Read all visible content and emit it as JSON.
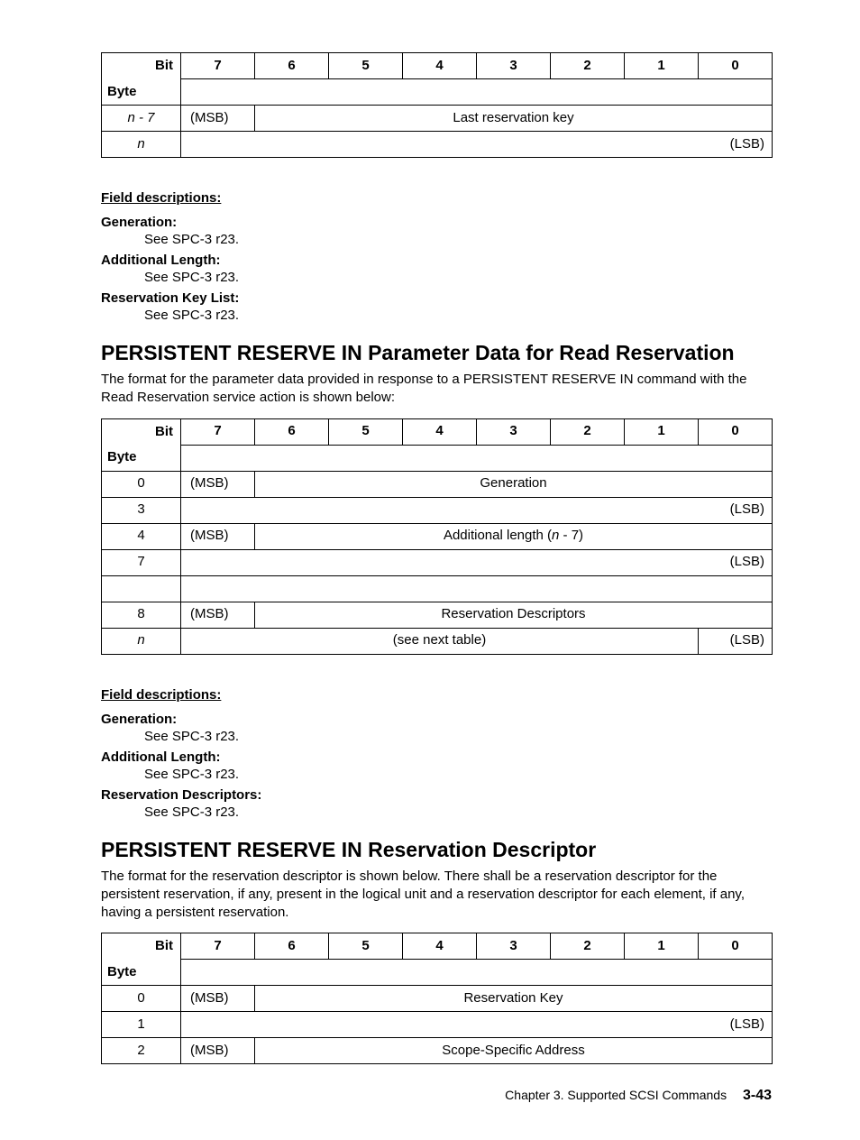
{
  "bitHeader": {
    "bit": "Bit",
    "byte": "Byte",
    "cols": [
      "7",
      "6",
      "5",
      "4",
      "3",
      "2",
      "1",
      "0"
    ]
  },
  "tableA": {
    "row_msb_byte": "n - 7",
    "row_msb_msb": "(MSB)",
    "row_msb_text": "Last reservation key",
    "row_lsb_byte": "n",
    "row_lsb_lsb": "(LSB)"
  },
  "fdA": {
    "title": "Field descriptions:",
    "items": [
      {
        "term": "Generation:",
        "def": "See SPC-3 r23."
      },
      {
        "term": "Additional Length:",
        "def": "See SPC-3 r23."
      },
      {
        "term": "Reservation Key List:",
        "def": "See SPC-3 r23."
      }
    ]
  },
  "sectionB": {
    "heading": "PERSISTENT RESERVE IN Parameter Data for Read Reservation",
    "lead": "The format for the parameter data provided in response to a PERSISTENT RESERVE IN command with the Read Reservation service action is shown below:"
  },
  "tableB": {
    "r1_byte": "0",
    "r1_msb": "(MSB)",
    "r1_text": "Generation",
    "r2_byte": "3",
    "r2_lsb": "(LSB)",
    "r3_byte": "4",
    "r3_msb": "(MSB)",
    "r3_text_a": "Additional length (",
    "r3_text_i": "n",
    "r3_text_b": " - 7)",
    "r4_byte": "7",
    "r4_lsb": "(LSB)",
    "r6_byte": "8",
    "r6_msb": "(MSB)",
    "r6_text": "Reservation Descriptors",
    "r7_byte": "n",
    "r7_text": "(see next table)",
    "r7_lsb": "(LSB)"
  },
  "fdB": {
    "title": "Field descriptions:",
    "items": [
      {
        "term": "Generation:",
        "def": "See SPC-3 r23."
      },
      {
        "term": "Additional Length:",
        "def": "See SPC-3 r23."
      },
      {
        "term": "Reservation Descriptors:",
        "def": "See SPC-3 r23."
      }
    ]
  },
  "sectionC": {
    "heading": "PERSISTENT RESERVE IN Reservation Descriptor",
    "lead": "The format for the reservation descriptor is shown below. There shall be a reservation descriptor for the persistent reservation, if any, present in the logical unit and a reservation descriptor for each element, if any, having a persistent reservation."
  },
  "tableC": {
    "r1_byte": "0",
    "r1_msb": "(MSB)",
    "r1_text": "Reservation Key",
    "r2_byte": "1",
    "r2_lsb": "(LSB)",
    "r3_byte": "2",
    "r3_msb": "(MSB)",
    "r3_text": "Scope-Specific Address"
  },
  "footer": {
    "chapter": "Chapter 3. Supported SCSI Commands",
    "page": "3-43"
  }
}
